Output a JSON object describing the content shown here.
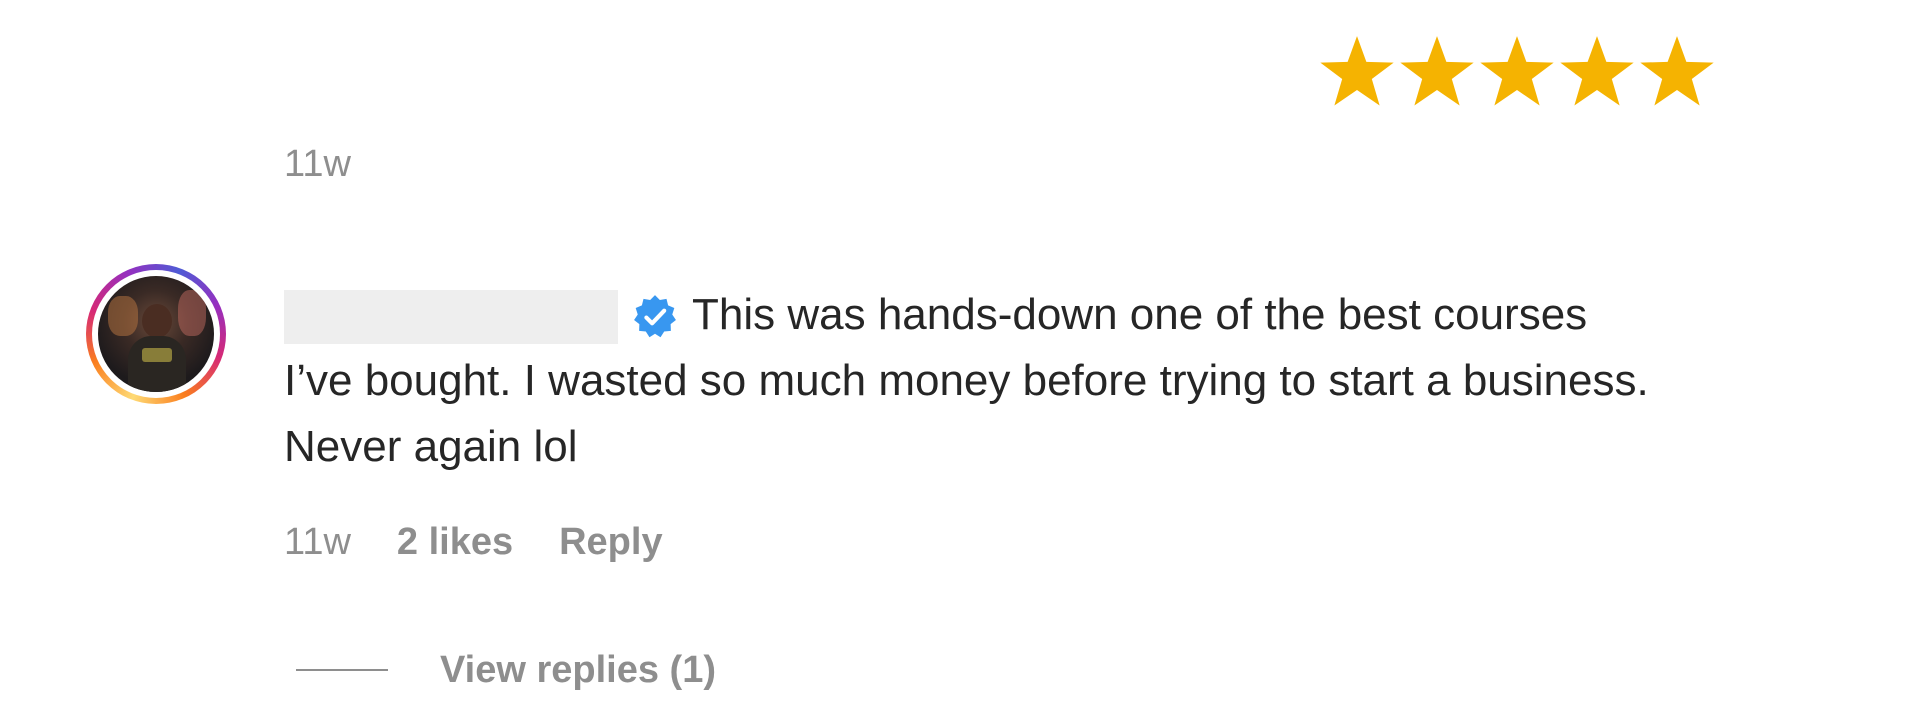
{
  "rating": {
    "value": 5,
    "max": 5,
    "star_color": "#F5B301"
  },
  "previous_comment": {
    "timestamp": "11w"
  },
  "comment": {
    "avatar_icon": "user-avatar",
    "verified_badge_icon": "verified-badge-icon",
    "verified_badge_color": "#3897F0",
    "text": "This was hands-down one of the best courses I’ve bought. I wasted so much money before trying to start a business. Never again lol",
    "timestamp": "11w",
    "likes_label": "2 likes",
    "reply_label": "Reply",
    "view_replies_label": "View replies (1)"
  },
  "colors": {
    "primary_text": "#262626",
    "secondary_text": "#8E8E8E",
    "redaction": "#EEEEEE"
  }
}
